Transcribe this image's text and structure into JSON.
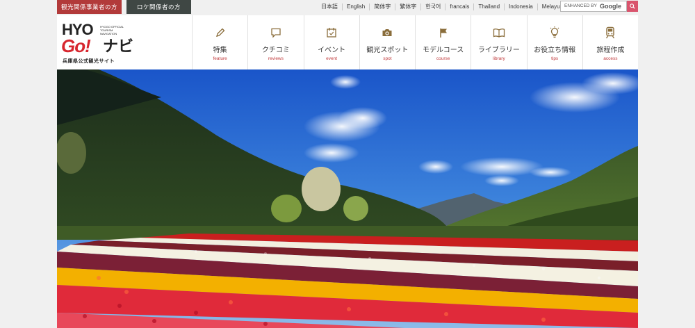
{
  "topbar": {
    "tourism_business_label": "観光関係事業者の方",
    "location_label": "ロケ関係者の方",
    "languages": [
      "日本語",
      "English",
      "简体字",
      "繁体字",
      "한국어",
      "francais",
      "Thailand",
      "Indonesia",
      "Melayu"
    ],
    "search": {
      "label": "ENHANCED BY",
      "brand": "Google"
    }
  },
  "logo": {
    "main": "HYOGo!ナビ",
    "small": "HYOGO OFFICIAL TOURISM NAVIGATION",
    "sub": "兵庫県公式観光サイト"
  },
  "nav": [
    {
      "jp": "特集",
      "en": "feature",
      "icon": "pencil-icon"
    },
    {
      "jp": "クチコミ",
      "en": "reviews",
      "icon": "speech-bubble-icon"
    },
    {
      "jp": "イベント",
      "en": "event",
      "icon": "calendar-icon"
    },
    {
      "jp": "観光スポット",
      "en": "spot",
      "icon": "camera-icon"
    },
    {
      "jp": "モデルコース",
      "en": "course",
      "icon": "flag-icon"
    },
    {
      "jp": "ライブラリー",
      "en": "library",
      "icon": "book-icon"
    },
    {
      "jp": "お役立ち情報",
      "en": "tips",
      "icon": "lightbulb-icon"
    },
    {
      "jp": "旅程作成",
      "en": "access",
      "icon": "train-icon"
    }
  ],
  "colors": {
    "brand_red": "#c0393b",
    "dark_button": "#3f4744",
    "search_button": "#d9546d"
  },
  "hero": {
    "description_icon": "tulip-field-photo"
  }
}
